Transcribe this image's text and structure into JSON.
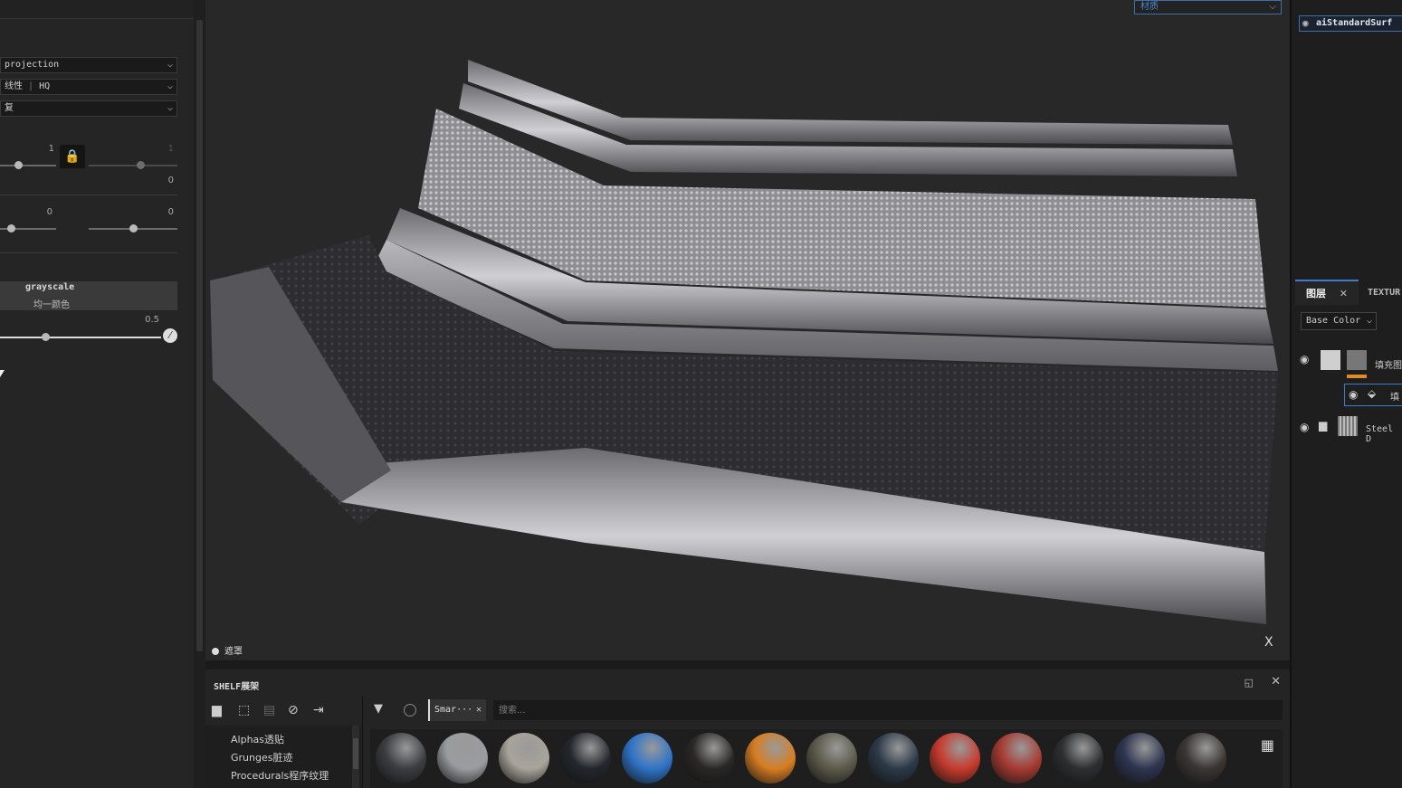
{
  "left_panel": {
    "projection_dd": "projection",
    "filtering_dd_part1": "线性",
    "filtering_dd_part2": "HQ",
    "tiling_dd": "复",
    "scale_left_value": "1",
    "scale_right_value": "1",
    "offset_value": "0",
    "rot_left_value": "0",
    "rot_right_value": "0",
    "grayscale_label": "grayscale",
    "grayscale_sub": "均一颜色",
    "grayscale_value": "0.5",
    "lock_glyph": "🔒"
  },
  "viewport": {
    "material_dd": "材质",
    "mask_label": "遮罩",
    "axis_label": "X"
  },
  "right_panel": {
    "shader_name": "aiStandardSurf",
    "tab_layers": "图层",
    "tab_texture": "TEXTUR",
    "channel_dd": "Base Color",
    "layer1_name": "填充图",
    "layer1_sub_name": "填",
    "layer2_name": "Steel D"
  },
  "shelf": {
    "title": "SHELF展架",
    "tree": [
      "Alphas透贴",
      "Grunges脏迹",
      "Procedurals程序纹理"
    ],
    "smart_chip": "Smar···",
    "search_placeholder": "搜索...",
    "balls": [
      "#3b3d41",
      "#9a9c9f",
      "#a9a49b",
      "#23272d",
      "#2f74c8",
      "#2a2826",
      "#d77d22",
      "#5c5a4a",
      "#2c3a48",
      "#c63b2e",
      "#a63b32",
      "#2d2f31",
      "#2e3550",
      "#3a3634"
    ]
  },
  "colors": {
    "accent_blue": "#3f7bd0",
    "accent_orange": "#e08a2a",
    "panel": "#252525",
    "viewport": "#282828"
  }
}
